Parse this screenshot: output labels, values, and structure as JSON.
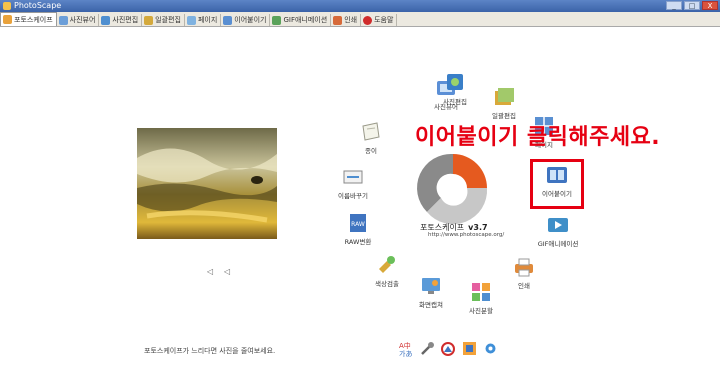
{
  "window": {
    "title": "PhotoScape",
    "min_label": "_",
    "max_label": "□",
    "close_label": "X"
  },
  "tabs": [
    {
      "label": "포토스케이프",
      "active": true,
      "color": "#e9a23b"
    },
    {
      "label": "사진뷰어",
      "color": "#6b9ed8"
    },
    {
      "label": "사진편집",
      "color": "#4f8fd0"
    },
    {
      "label": "일괄편집",
      "color": "#d4a93c"
    },
    {
      "label": "페이지",
      "color": "#7fb2e0"
    },
    {
      "label": "이어붙이기",
      "color": "#5a8fd2"
    },
    {
      "label": "GIF애니메이션",
      "color": "#5aa25a"
    },
    {
      "label": "인쇄",
      "color": "#d76a3a"
    },
    {
      "label": "도움말",
      "color": "#d02c2c"
    }
  ],
  "photo_nav": {
    "prev": "◁",
    "next": "◁"
  },
  "logo": {
    "name": "포토스케이프",
    "version": "v3.7",
    "url": "http://www.photoscape.org/"
  },
  "menu": {
    "viewer": "사진뷰어",
    "editor": "사진편집",
    "batch": "일괄편집",
    "page": "페이지",
    "combine": "이어붙이기",
    "gif": "GIF애니메이션",
    "print": "인쇄",
    "splitter": "사진분할",
    "screen_capture": "화면캡쳐",
    "color_picker": "색상검출",
    "raw": "RAW변환",
    "rename": "이름바꾸기",
    "paper": "종이"
  },
  "instruction": "이어붙이기 클릭해주세요.",
  "footer": "포토스케이프가 느리다면 사진을 줄여보세요.",
  "bottom_icons": [
    "language-icon",
    "tools-icon",
    "face-search-icon",
    "paper-icon",
    "settings-icon"
  ],
  "colors": {
    "accent_red": "#e60012",
    "titlebar": "#3b63a8"
  }
}
